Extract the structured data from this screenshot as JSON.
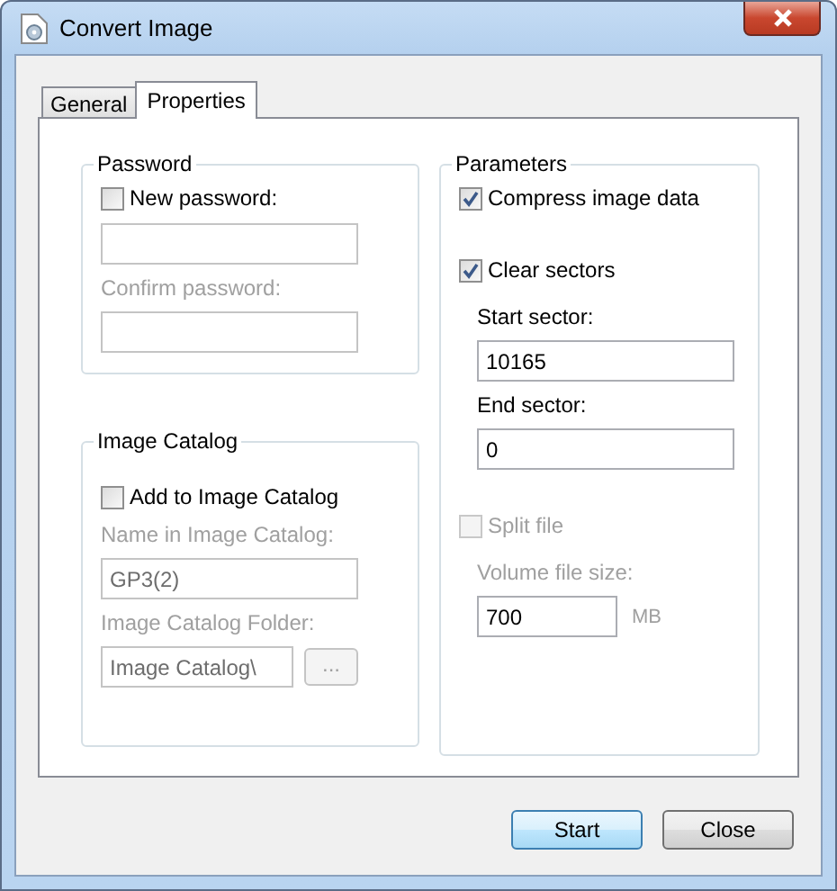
{
  "window": {
    "title": "Convert Image"
  },
  "tabs": [
    {
      "label": "General",
      "selected": false
    },
    {
      "label": "Properties",
      "selected": true
    }
  ],
  "columns": [
    {
      "groups": [
        {
          "title": "Password",
          "items": [
            {
              "kind": "checkbox",
              "label": "New password:",
              "checked": false,
              "disabled": false,
              "children": [
                {
                  "kind": "input",
                  "disabled": true
                },
                {
                  "kind": "label",
                  "text": "Confirm password:",
                  "disabled": true
                },
                {
                  "kind": "input",
                  "disabled": true
                }
              ]
            }
          ]
        },
        {
          "title": "Image Catalog",
          "items": [
            {
              "kind": "checkbox",
              "label": "Add to Image Catalog",
              "checked": false,
              "disabled": false,
              "children": [
                {
                  "kind": "label",
                  "text": "Name in Image Catalog:",
                  "disabled": true
                },
                {
                  "kind": "input",
                  "value": "GP3(2)",
                  "disabled": true
                },
                {
                  "kind": "label",
                  "text": "Image Catalog Folder:",
                  "disabled": true
                },
                {
                  "kind": "input",
                  "value": "Image Catalog\\",
                  "disabled": true,
                  "button": "..."
                }
              ]
            }
          ]
        }
      ]
    },
    {
      "groups": [
        {
          "title": "Parameters",
          "items": [
            {
              "kind": "checkbox",
              "label": "Compress image data",
              "checked": true,
              "disabled": false
            },
            {
              "kind": "checkbox",
              "label": "Clear sectors",
              "checked": true,
              "disabled": false,
              "indent_children": true,
              "children": [
                {
                  "kind": "label",
                  "text": "Start sector:",
                  "disabled": false
                },
                {
                  "kind": "input",
                  "value": "10165",
                  "disabled": false
                },
                {
                  "kind": "label",
                  "text": "End sector:",
                  "disabled": false
                },
                {
                  "kind": "input",
                  "value": "0",
                  "disabled": false
                }
              ]
            },
            {
              "kind": "checkbox",
              "label": "Split file",
              "checked": false,
              "disabled": true,
              "indent_children": true,
              "children": [
                {
                  "kind": "label",
                  "text": "Volume file size:",
                  "disabled": true
                },
                {
                  "kind": "input",
                  "value": "700",
                  "disabled": false,
                  "unit": "MB"
                }
              ]
            }
          ]
        }
      ]
    }
  ],
  "buttons": [
    {
      "label": "Start",
      "default": true
    },
    {
      "label": "Close",
      "default": false
    }
  ]
}
